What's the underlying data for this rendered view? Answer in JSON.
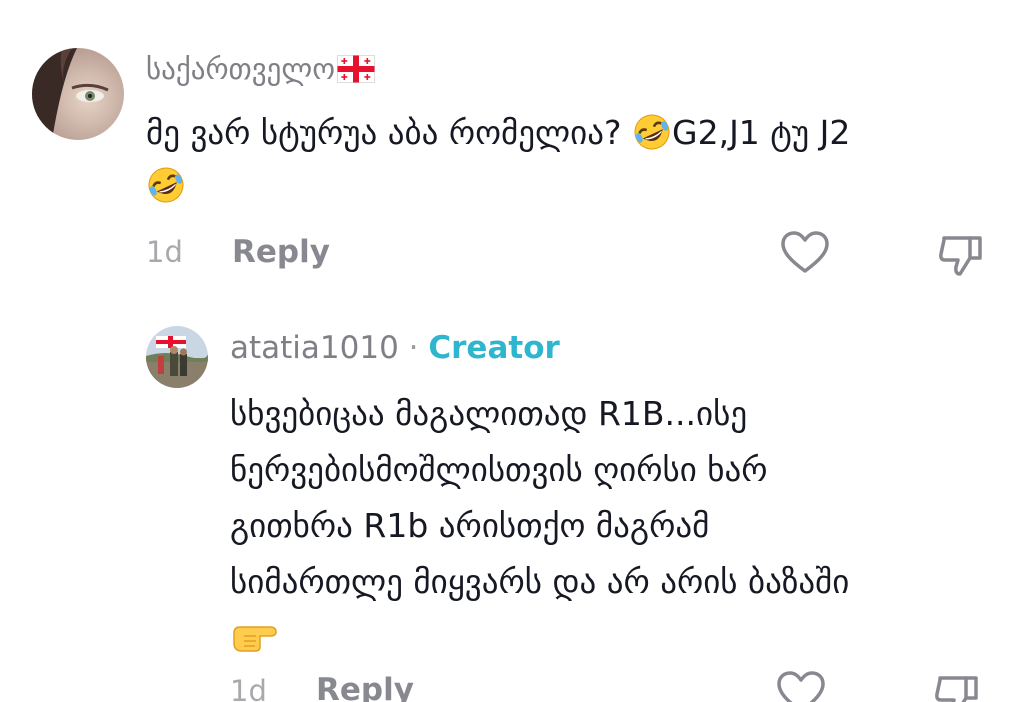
{
  "comment": {
    "username": "საქართველო",
    "username_flag_icon": "georgia-flag-icon",
    "text_lines": [
      "მე ვარ სტურუა აბა რომელია? ",
      "G2,J1 ტუ J2"
    ],
    "emoji_icon": "rolling-on-floor-laughing-emoji",
    "time": "1d",
    "reply_label": "Reply"
  },
  "reply": {
    "username": "atatia1010",
    "separator": "·",
    "badge": "Creator",
    "text_lines": [
      "სხვებიცაა მაგალითად R1B...ისე",
      "ნერვებისმოშლისთვის ღირსი ხარ",
      "გითხრა R1b არისთქო მაგრამ",
      "სიმართლე მიყვარს და არ არის ბაზაში"
    ],
    "emoji_icon": "backhand-index-pointing-right-emoji",
    "time": "1d",
    "reply_label": "Reply"
  },
  "colors": {
    "creator_badge": "#2fb6cf",
    "meta_gray": "#a8a8ad",
    "username_gray": "#7f7f86",
    "text": "#161823"
  }
}
